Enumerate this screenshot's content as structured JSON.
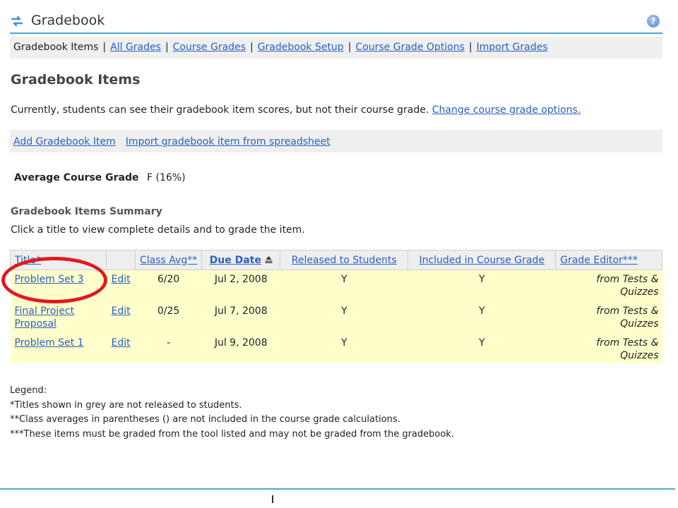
{
  "header": {
    "title": "Gradebook",
    "help_glyph": "?",
    "accent_color": "#4aa8d8"
  },
  "nav": {
    "current": "Gradebook Items",
    "sep": "|",
    "links": [
      "All Grades",
      "Course Grades",
      "Gradebook Setup",
      "Course Grade Options",
      "Import Grades"
    ]
  },
  "page": {
    "heading": "Gradebook Items",
    "status_text": "Currently, students can see their gradebook item scores, but not their course grade.",
    "status_link": "Change course grade options."
  },
  "actions": {
    "add_item": "Add Gradebook Item",
    "import_item": "Import gradebook item from spreadsheet"
  },
  "average": {
    "label": "Average Course Grade",
    "value": "F (16%)"
  },
  "summary": {
    "heading": "Gradebook Items Summary",
    "instructions": "Click a title to view complete details and to grade the item."
  },
  "table": {
    "headers": {
      "title": "Title*",
      "edit": "",
      "class_avg": "Class Avg**",
      "due_date": "Due Date",
      "released": "Released to Students",
      "included": "Included in Course Grade",
      "grade_editor": "Grade Editor***"
    },
    "rows": [
      {
        "title": "Problem Set 3",
        "edit": "Edit",
        "class_avg": "6/20",
        "due_date": "Jul 2, 2008",
        "released": "Y",
        "included": "Y",
        "editor_line1": "from Tests &",
        "editor_line2": "Quizzes"
      },
      {
        "title_line1": "Final Project",
        "title_line2": "Proposal",
        "edit": "Edit",
        "class_avg": "0/25",
        "due_date": "Jul 7, 2008",
        "released": "Y",
        "included": "Y",
        "editor_line1": "from Tests &",
        "editor_line2": "Quizzes"
      },
      {
        "title": "Problem Set 1",
        "edit": "Edit",
        "class_avg": "-",
        "due_date": "Jul 9, 2008",
        "released": "Y",
        "included": "Y",
        "editor_line1": "from Tests &",
        "editor_line2": "Quizzes"
      }
    ],
    "row_color": "#ffffcc",
    "highlight_color": "#e3181f"
  },
  "legend": {
    "heading": "Legend:",
    "lines": [
      "*Titles shown in grey are not released to students.",
      "**Class averages in parentheses () are not included in the course grade calculations.",
      "***These items must be graded from the tool listed and may not be graded from the gradebook."
    ]
  }
}
